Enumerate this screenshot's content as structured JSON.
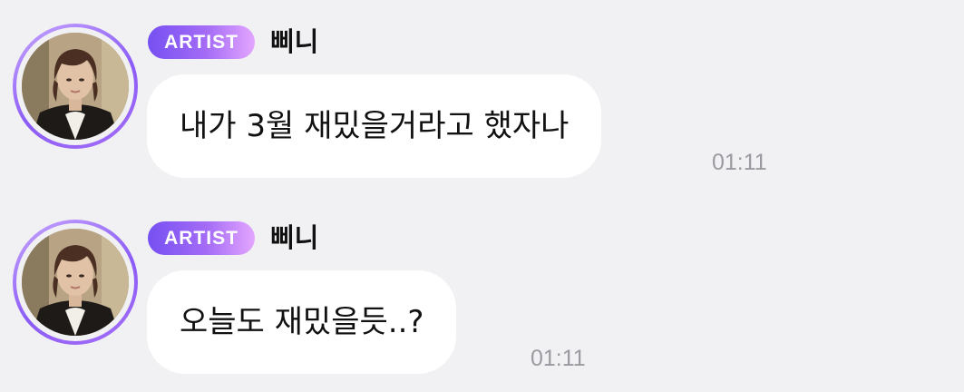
{
  "chat": {
    "messages": [
      {
        "badge": "ARTIST",
        "sender": "삐니",
        "text": "내가 3월 재밌을거라고 했자나",
        "time": "01:11"
      },
      {
        "badge": "ARTIST",
        "sender": "삐니",
        "text": "오늘도 재밌을듯..?",
        "time": "01:11"
      }
    ]
  },
  "colors": {
    "background": "#f1f1f3",
    "bubble": "#ffffff",
    "badge_gradient": [
      "#7650f2",
      "#a46cf6",
      "#e3a6ff"
    ],
    "avatar_ring": "#8b5cf6",
    "timestamp": "#9a9aa0"
  },
  "icons": {
    "avatar": "artist-profile-photo"
  }
}
